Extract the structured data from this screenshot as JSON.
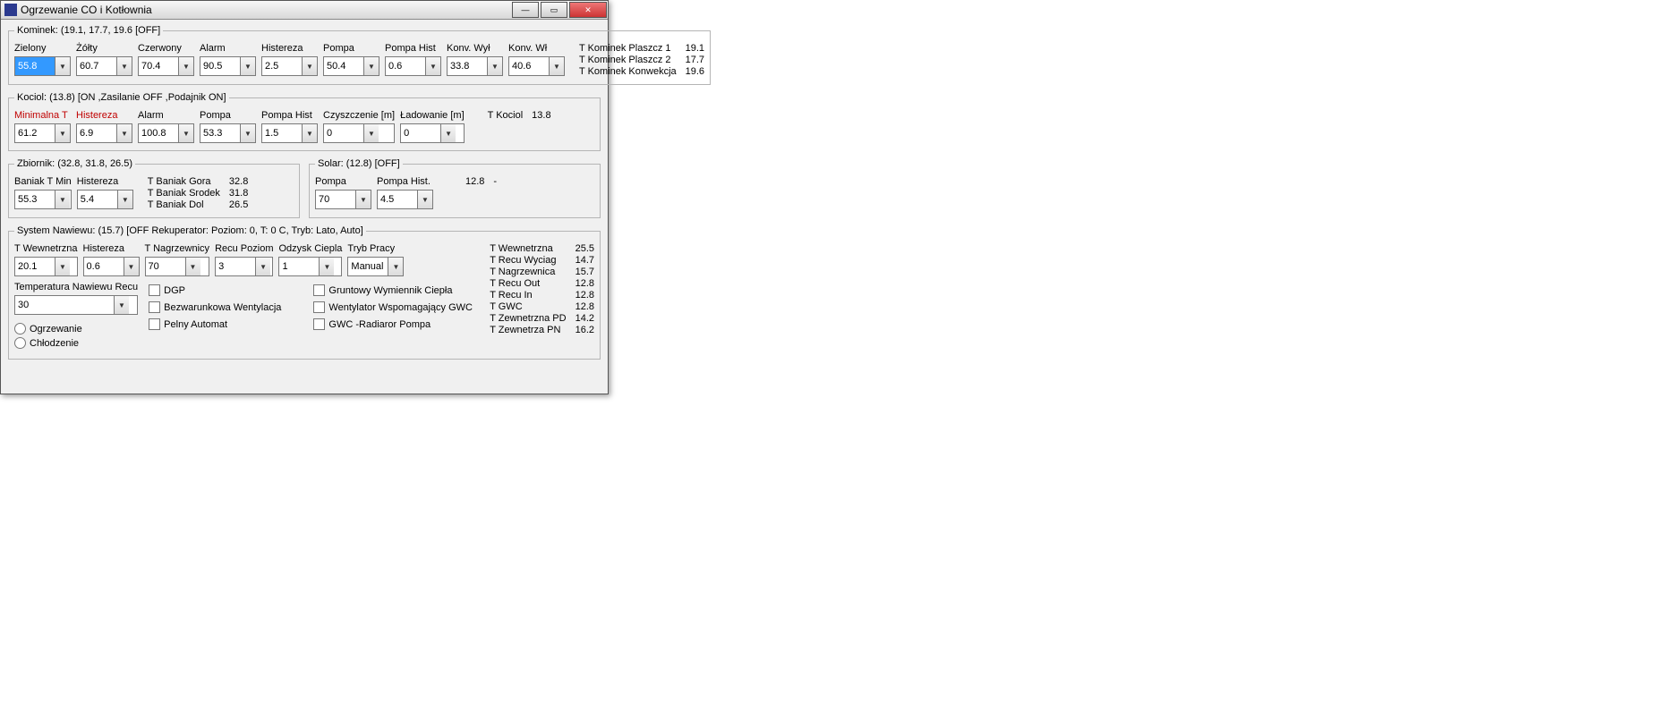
{
  "window": {
    "title": "Ogrzewanie CO i Kotłownia"
  },
  "kominek": {
    "legend": "Kominek: (19.1, 17.7, 19.6 [OFF]",
    "fields": [
      {
        "label": "Zielony",
        "value": "55.8",
        "sel": true
      },
      {
        "label": "Żółty",
        "value": "60.7"
      },
      {
        "label": "Czerwony",
        "value": "70.4"
      },
      {
        "label": "Alarm",
        "value": "90.5"
      },
      {
        "label": "Histereza",
        "value": "2.5"
      },
      {
        "label": "Pompa",
        "value": "50.4"
      },
      {
        "label": "Pompa Hist",
        "value": "0.6"
      },
      {
        "label": "Konv. Wył",
        "value": "33.8"
      },
      {
        "label": "Konv. Wł",
        "value": "40.6"
      }
    ],
    "readouts": [
      {
        "k": "T Kominek Plaszcz 1",
        "v": "19.1"
      },
      {
        "k": "T Kominek Plaszcz 2",
        "v": "17.7"
      },
      {
        "k": "T Kominek Konwekcja",
        "v": "19.6"
      }
    ]
  },
  "kociol": {
    "legend": "Kociol: (13.8) [ON ,Zasilanie OFF ,Podajnik ON]",
    "fields": [
      {
        "label": "Minimalna T",
        "value": "61.2",
        "red": true
      },
      {
        "label": "Histereza",
        "value": "6.9",
        "red": true
      },
      {
        "label": "Alarm",
        "value": "100.8"
      },
      {
        "label": "Pompa",
        "value": "53.3"
      },
      {
        "label": "Pompa Hist",
        "value": "1.5"
      },
      {
        "label": "Czyszczenie [m]",
        "value": "0"
      },
      {
        "label": "Ładowanie [m]",
        "value": "0"
      }
    ],
    "readouts": [
      {
        "k": "T Kociol",
        "v": "13.8"
      }
    ]
  },
  "zbiornik": {
    "legend": "Zbiornik: (32.8, 31.8, 26.5)",
    "fields": [
      {
        "label": "Baniak T Min",
        "value": "55.3"
      },
      {
        "label": "Histereza",
        "value": "5.4"
      }
    ],
    "readouts": [
      {
        "k": "T Baniak Gora",
        "v": "32.8"
      },
      {
        "k": "T Baniak Srodek",
        "v": "31.8"
      },
      {
        "k": "T Baniak Dol",
        "v": "26.5"
      }
    ]
  },
  "solar": {
    "legend": "Solar: (12.8) [OFF]",
    "fields": [
      {
        "label": "Pompa",
        "value": "70"
      },
      {
        "label": "Pompa Hist.",
        "value": "4.5"
      }
    ],
    "readouts": [
      {
        "k": "12.8",
        "v": "-"
      }
    ]
  },
  "nawiew": {
    "legend": "System Nawiewu: (15.7) [OFF Rekuperator: Poziom: 0, T: 0 C, Tryb: Lato, Auto]",
    "fields": [
      {
        "label": "T Wewnetrzna",
        "value": "20.1"
      },
      {
        "label": "Histereza",
        "value": "0.6"
      },
      {
        "label": "T Nagrzewnicy",
        "value": "70"
      },
      {
        "label": "Recu Poziom",
        "value": "3"
      },
      {
        "label": "Odzysk Ciepla",
        "value": "1"
      },
      {
        "label": "Tryb Pracy",
        "value": "Manual"
      }
    ],
    "temp_label": "Temperatura Nawiewu Recu",
    "temp_value": "30",
    "checks_col1": [
      {
        "label": "DGP"
      },
      {
        "label": "Bezwarunkowa Wentylacja"
      },
      {
        "label": "Pelny Automat"
      }
    ],
    "checks_col2": [
      {
        "label": "Gruntowy Wymiennik Ciepła"
      },
      {
        "label": "Wentylator Wspomagający GWC"
      },
      {
        "label": "GWC -Radiaror Pompa"
      }
    ],
    "radios": [
      {
        "label": "Ogrzewanie"
      },
      {
        "label": "Chłodzenie"
      }
    ],
    "readouts": [
      {
        "k": "T Wewnetrzna",
        "v": "25.5"
      },
      {
        "k": "T Recu Wyciag",
        "v": "14.7"
      },
      {
        "k": "T Nagrzewnica",
        "v": "15.7"
      },
      {
        "k": "T Recu Out",
        "v": "12.8"
      },
      {
        "k": "T Recu In",
        "v": "12.8"
      },
      {
        "k": "T GWC",
        "v": "12.8"
      },
      {
        "k": "T Zewnetrzna PD",
        "v": "14.2"
      },
      {
        "k": "T Zewnetrza PN",
        "v": "16.2"
      }
    ]
  }
}
